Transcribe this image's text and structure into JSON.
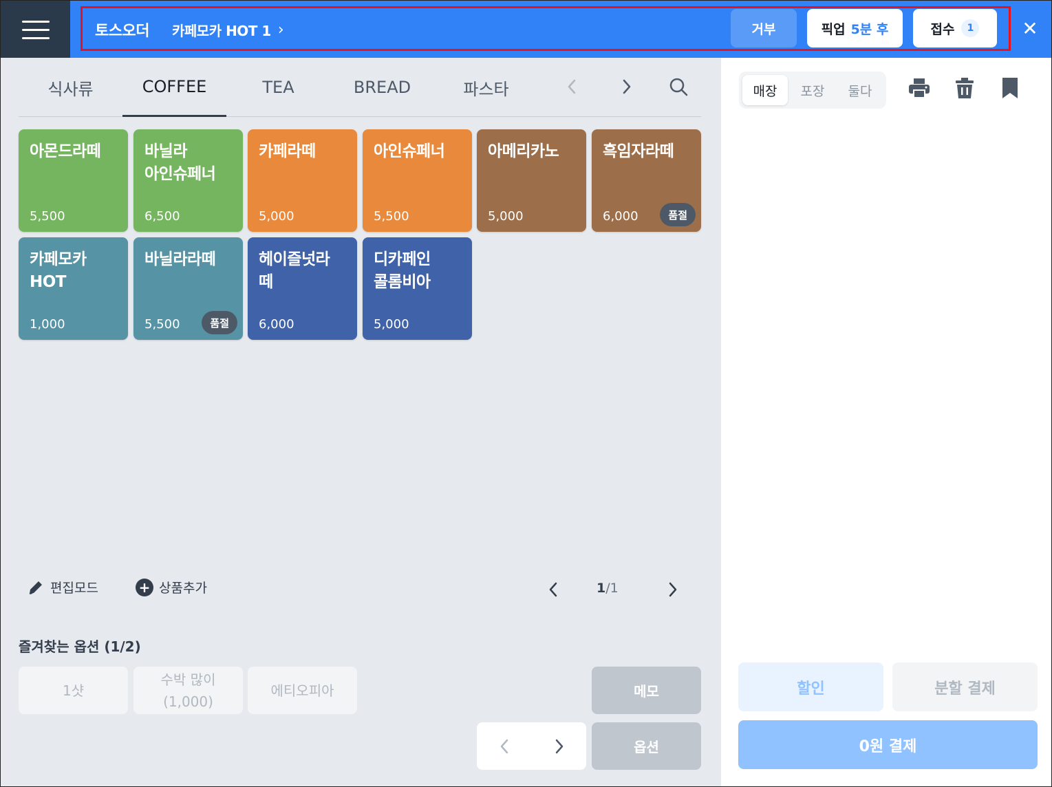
{
  "header": {
    "brand": "토스오더",
    "order_title": "카페모카 HOT 1",
    "reject_label": "거부",
    "pickup_label": "픽업",
    "pickup_time": "5분 후",
    "accept_label": "접수",
    "accept_count": "1",
    "colors": {
      "bar": "#3182f6",
      "highlight": "#e8111c"
    }
  },
  "tabs": [
    {
      "label": "식사류"
    },
    {
      "label": "COFFEE",
      "active": true
    },
    {
      "label": "TEA"
    },
    {
      "label": "BREAD"
    },
    {
      "label": "파스타"
    }
  ],
  "products": [
    {
      "name": "아몬드라떼",
      "price": "5,500",
      "color": "#76b55f"
    },
    {
      "name": "바닐라\n아인슈페너",
      "price": "6,500",
      "color": "#76b55f"
    },
    {
      "name": "카페라떼",
      "price": "5,000",
      "color": "#e8893b"
    },
    {
      "name": "아인슈페너",
      "price": "5,500",
      "color": "#e8893b"
    },
    {
      "name": "아메리카노",
      "price": "5,000",
      "color": "#9c6e4a"
    },
    {
      "name": "흑임자라떼",
      "price": "6,000",
      "color": "#9c6e4a",
      "soldout": "품절"
    },
    {
      "name": "카페모카\nHOT",
      "price": "1,000",
      "color": "#5694a5"
    },
    {
      "name": "바닐라라떼",
      "price": "5,500",
      "color": "#5694a5",
      "soldout": "품절"
    },
    {
      "name": "헤이즐넛라\n떼",
      "price": "6,000",
      "color": "#3f62a8"
    },
    {
      "name": "디카페인\n콜롬비아",
      "price": "5,000",
      "color": "#3f62a8"
    }
  ],
  "tools": {
    "edit_label": "편집모드",
    "add_label": "상품추가",
    "page_current": "1",
    "page_sep": "/",
    "page_total": "1"
  },
  "favorites": {
    "title": "즐겨찾는 옵션 (1/2)",
    "options": [
      {
        "label": "1샷",
        "sub": ""
      },
      {
        "label": "수박 많이",
        "sub": "(1,000)"
      },
      {
        "label": "에티오피아",
        "sub": ""
      }
    ],
    "memo_label": "메모",
    "option_label": "옵션"
  },
  "cart": {
    "segments": [
      {
        "label": "매장",
        "active": true
      },
      {
        "label": "포장"
      },
      {
        "label": "둘다"
      }
    ],
    "icons": [
      "printer-icon",
      "trash-icon",
      "bookmark-icon"
    ],
    "discount_label": "할인",
    "split_label": "분할 결제",
    "pay_label": "0원 결제"
  }
}
